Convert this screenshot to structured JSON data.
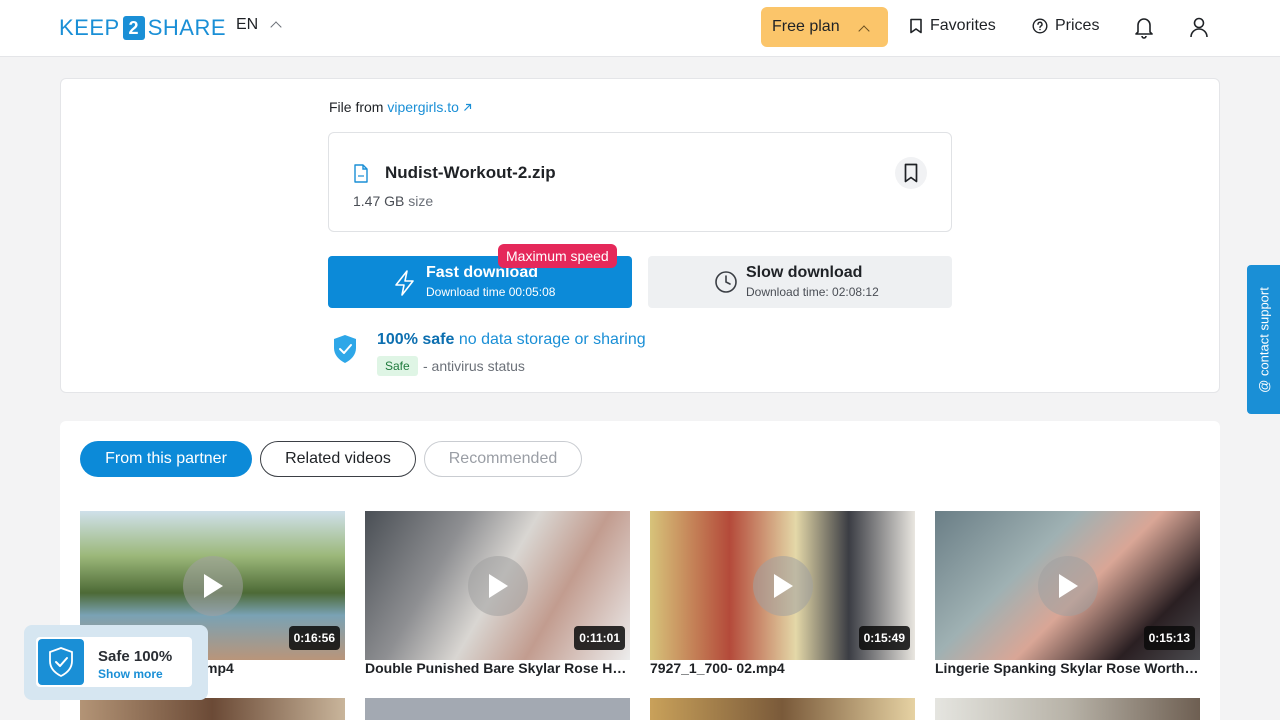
{
  "header": {
    "logo_left": "KEEP",
    "logo_mid": "2",
    "logo_right": "SHARE",
    "lang": "EN",
    "plan_label": "Free plan",
    "favorites_label": "Favorites",
    "prices_label": "Prices"
  },
  "file": {
    "from_prefix": "File from",
    "from_site": "vipergirls.to",
    "name": "Nudist-Workout-2.zip",
    "size_value": "1.47 GB",
    "size_suffix": "size",
    "fast_title": "Fast download",
    "fast_sub": "Download time 00:05:08",
    "max_badge": "Maximum speed",
    "slow_title": "Slow download",
    "slow_sub": "Download time: 02:08:12",
    "safe_bold": "100% safe",
    "safe_rest": "no data storage or sharing",
    "safe_tag": "Safe",
    "antivirus": "- antivirus status"
  },
  "tabs": {
    "partner": "From this partner",
    "related": "Related videos",
    "recommended": "Recommended"
  },
  "videos": [
    {
      "title": "mp4",
      "duration": "0:16:56"
    },
    {
      "title": "Double Punished Bare Skylar Rose Hair…",
      "duration": "0:11:01"
    },
    {
      "title": "7927_1_700- 02.mp4",
      "duration": "0:15:49"
    },
    {
      "title": "Lingerie Spanking Skylar Rose Worth th…",
      "duration": "0:15:13"
    }
  ],
  "contact_support": "@ contact support",
  "safe_widget": {
    "title": "Safe 100%",
    "more": "Show more"
  },
  "colors": {
    "brand": "#1a8fd6",
    "plan": "#fbc56a",
    "badge": "#e5285a"
  }
}
